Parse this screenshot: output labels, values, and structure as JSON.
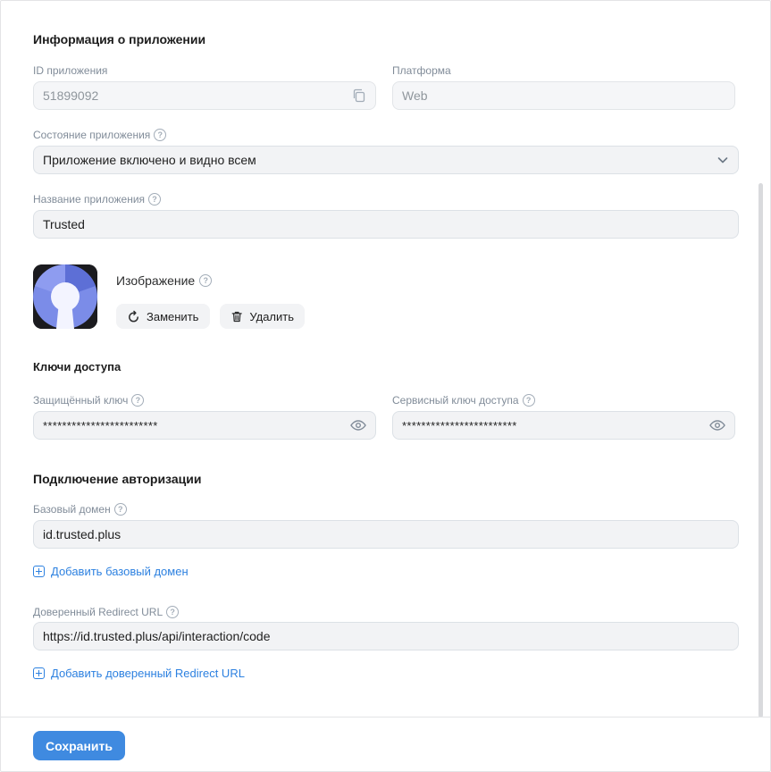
{
  "app_info": {
    "title": "Информация о приложении",
    "id_label": "ID приложения",
    "id_value": "51899092",
    "platform_label": "Платформа",
    "platform_value": "Web",
    "state_label": "Состояние приложения",
    "state_value": "Приложение включено и видно всем",
    "name_label": "Название приложения",
    "name_value": "Trusted",
    "image_label": "Изображение",
    "replace_label": "Заменить",
    "delete_label": "Удалить"
  },
  "keys": {
    "title": "Ключи доступа",
    "protected_label": "Защищённый ключ",
    "protected_value": "************************",
    "service_label": "Сервисный ключ доступа",
    "service_value": "************************"
  },
  "auth": {
    "title": "Подключение авторизации",
    "domain_label": "Базовый домен",
    "domain_value": "id.trusted.plus",
    "add_domain_label": "Добавить базовый домен",
    "redirect_label": "Доверенный Redirect URL",
    "redirect_value": "https://id.trusted.plus/api/interaction/code",
    "add_redirect_label": "Добавить доверенный Redirect URL"
  },
  "footer": {
    "save_label": "Сохранить"
  },
  "help_glyph": "?",
  "colors": {
    "accent": "#3f8ae0",
    "link": "#2d81e0",
    "field_bg": "#f2f3f5",
    "muted": "#818c99"
  },
  "icons": [
    "copy-icon",
    "chevron-down-icon",
    "help-icon",
    "refresh-icon",
    "trash-icon",
    "eye-icon",
    "plus-square-icon",
    "keyhole-logo"
  ]
}
